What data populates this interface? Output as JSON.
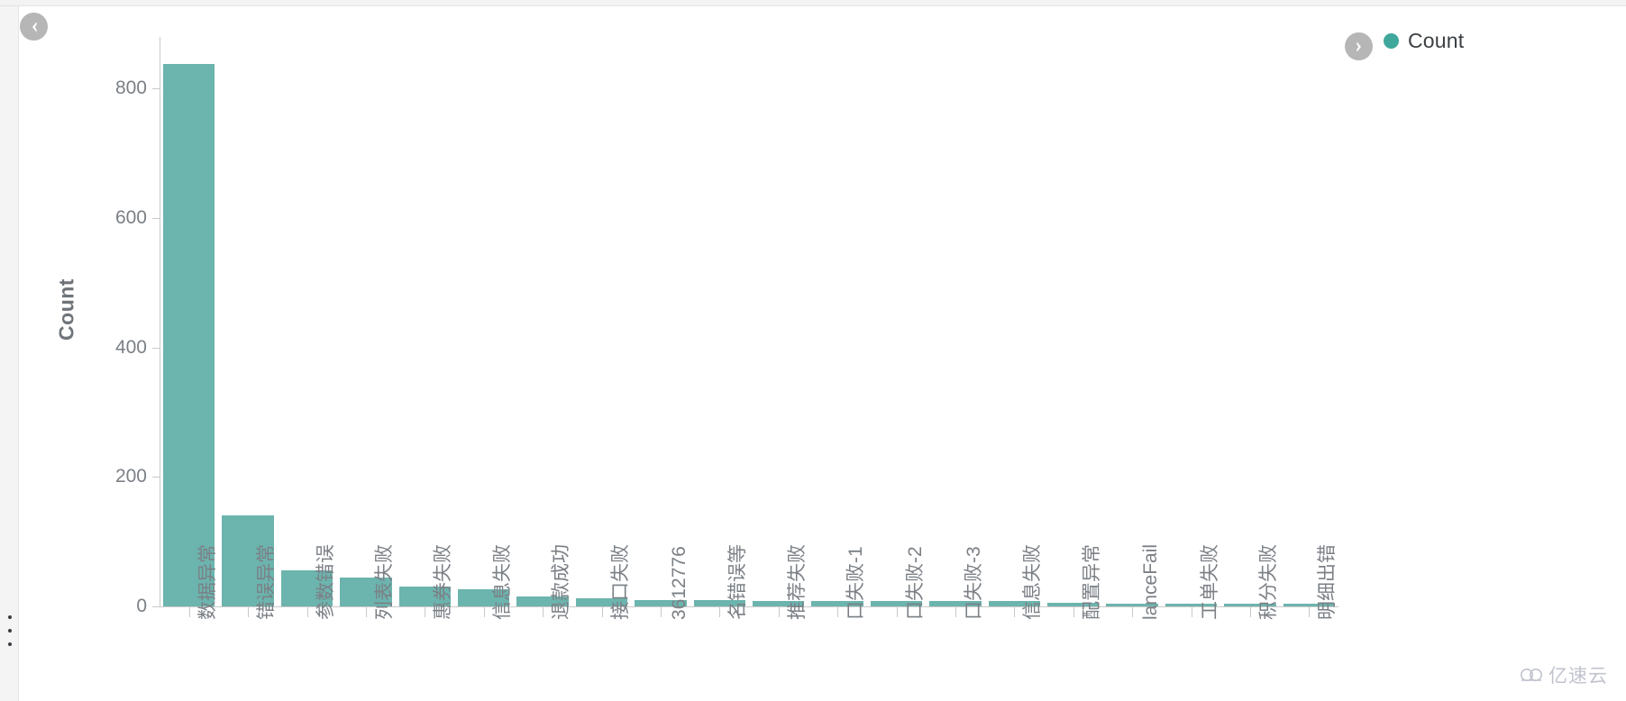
{
  "window": {
    "background_color": "#ffffff",
    "top_bar_color": "#f3f3f3",
    "left_rail_color": "#f4f4f4"
  },
  "controls": {
    "prev_button": {
      "name": "previous-page-button",
      "icon": "chevron-left-icon",
      "color": "#b6b6b6"
    },
    "next_button": {
      "name": "next-page-button",
      "icon": "chevron-right-icon",
      "color": "#b6b6b6"
    },
    "drag_handle": {
      "name": "panel-drag-handle",
      "icon": "vertical-dots-icon"
    }
  },
  "legend": {
    "position": "top-right",
    "entries": [
      {
        "label": "Count",
        "color": "#3fa79b",
        "marker": "circle"
      }
    ]
  },
  "watermark": {
    "text": "亿速云",
    "icon": "cloud-icon",
    "color": "#8d93a6"
  },
  "chart_data": {
    "type": "bar",
    "title": "",
    "subtitle": "",
    "xlabel": "",
    "ylabel": "Count",
    "ylim": [
      0,
      880
    ],
    "yticks": [
      0,
      200,
      400,
      600,
      800
    ],
    "grid": false,
    "legend_position": "top-right",
    "bar_color": "#6cb4ae",
    "categories": [
      "数据异常",
      "错误异常",
      "参数错误",
      "列表失败",
      "惠券失败",
      "信息失败",
      "退款成功",
      "接口失败",
      "3612776",
      "名错误等",
      "推荐失败",
      "口失败-1",
      "口失败-2",
      "口失败-3",
      "信息失败",
      "配置异常",
      "lanceFail",
      "工单失败",
      "积分失败",
      "明细出错"
    ],
    "series": [
      {
        "name": "Count",
        "color": "#6cb4ae",
        "values": [
          838,
          140,
          56,
          45,
          30,
          27,
          15,
          13,
          10,
          10,
          8,
          8,
          8,
          8,
          8,
          6,
          4,
          4,
          3,
          3
        ]
      }
    ]
  }
}
